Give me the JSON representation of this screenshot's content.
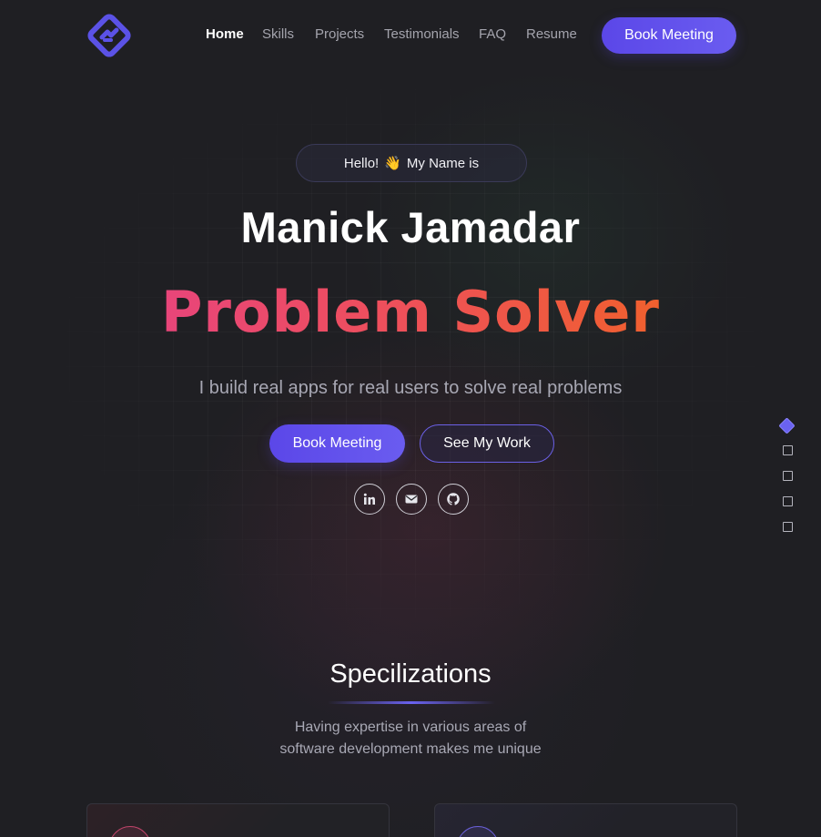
{
  "nav": {
    "logo_icon": "diamond-logo-icon",
    "items": [
      {
        "label": "Home",
        "active": true
      },
      {
        "label": "Skills",
        "active": false
      },
      {
        "label": "Projects",
        "active": false
      },
      {
        "label": "Testimonials",
        "active": false
      },
      {
        "label": "FAQ",
        "active": false
      },
      {
        "label": "Resume",
        "active": false
      }
    ],
    "cta_label": "Book Meeting"
  },
  "hero": {
    "greeting_before": "Hello!",
    "greeting_emoji": "👋",
    "greeting_after": "My Name is",
    "name": "Manick Jamadar",
    "role": "Problem Solver",
    "tagline": "I build real apps for real users to solve real problems",
    "primary_button": "Book Meeting",
    "secondary_button": "See My Work",
    "socials": [
      "linkedin-icon",
      "mail-icon",
      "github-icon"
    ]
  },
  "side_nav": {
    "count": 5,
    "active_index": 0
  },
  "specializations": {
    "title": "Specilizations",
    "subtitle_line1": "Having expertise in various areas of",
    "subtitle_line2": "software development makes me unique"
  },
  "colors": {
    "accent": "#5b47e8",
    "role_gradient_start": "#e8457a",
    "role_gradient_end": "#f0602e",
    "background": "#1f1f23"
  }
}
